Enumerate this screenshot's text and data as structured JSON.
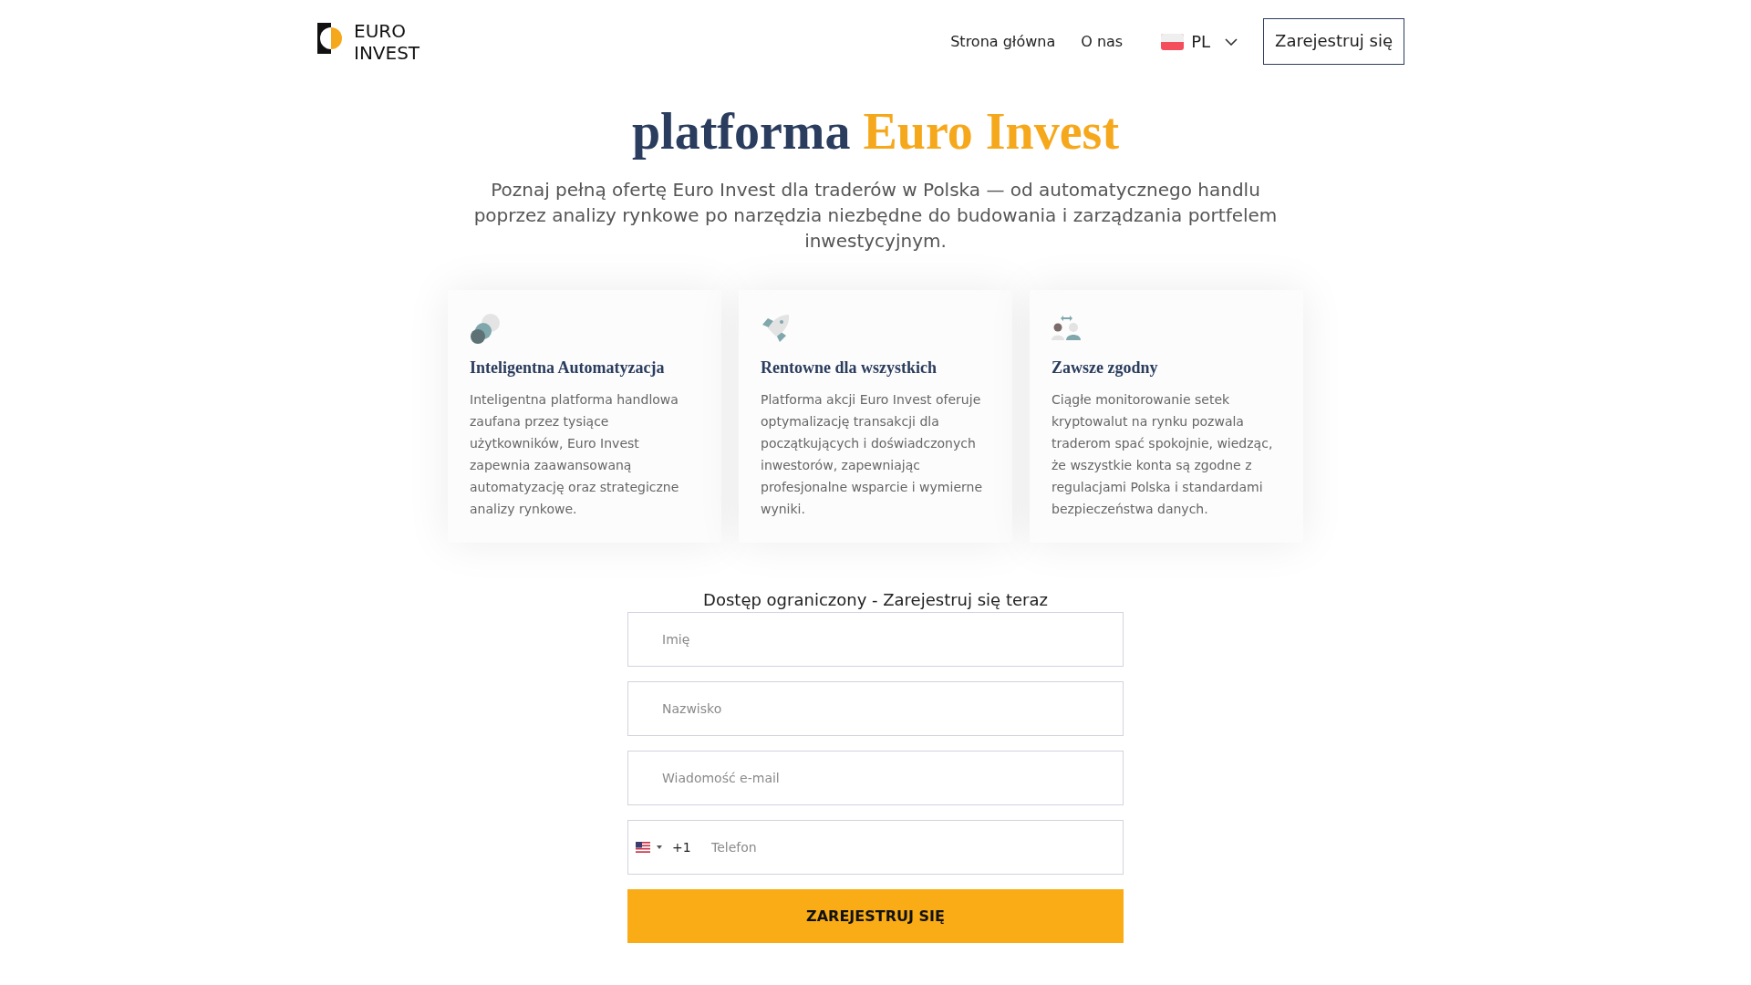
{
  "header": {
    "logo_lines": [
      "EURO",
      "INVEST"
    ],
    "nav": [
      {
        "label": "Strona główna"
      },
      {
        "label": "O nas"
      }
    ],
    "language": "PL",
    "cta": "Zarejestruj się"
  },
  "hero": {
    "title_parts": [
      {
        "text": "platforma",
        "accent": false
      },
      {
        "text": "Euro Invest",
        "accent": true
      }
    ],
    "subtitle": "Poznaj pełną ofertę Euro Invest dla traderów w Polska — od automatycznego handlu poprzez analizy rynkowe po narzędzia niezbędne do budowania i zarządzania portfelem inwestycyjnym."
  },
  "features": [
    {
      "title": "Inteligentna Automatyzacja",
      "text": "Inteligentna platforma handlowa zaufana przez tysiące użytkowników, Euro Invest zapewnia zaawansowaną automatyzację oraz strategiczne analizy rynkowe."
    },
    {
      "title": "Rentowne dla wszystkich",
      "text": "Platforma akcji Euro Invest oferuje optymalizację transakcji dla początkujących i doświadczonych inwestorów, zapewniając profesjonalne wsparcie i wymierne wyniki."
    },
    {
      "title": "Zawsze zgodny",
      "text": "Ciągłe monitorowanie setek kryptowalut na rynku pozwala traderom spać spokojnie, wiedząc, że wszystkie konta są zgodne z regulacjami Polska i standardami bezpieczeństwa danych."
    }
  ],
  "signup": {
    "heading": "Dostęp ograniczony - Zarejestruj się teraz",
    "fields": [
      {
        "placeholder": "Imię"
      },
      {
        "placeholder": "Nazwisko"
      },
      {
        "placeholder": "Wiadomość e-mail"
      }
    ],
    "phone": {
      "dial_code": "+1",
      "placeholder": "Telefon"
    },
    "submit": "ZAREJESTRUJ SIĘ"
  }
}
